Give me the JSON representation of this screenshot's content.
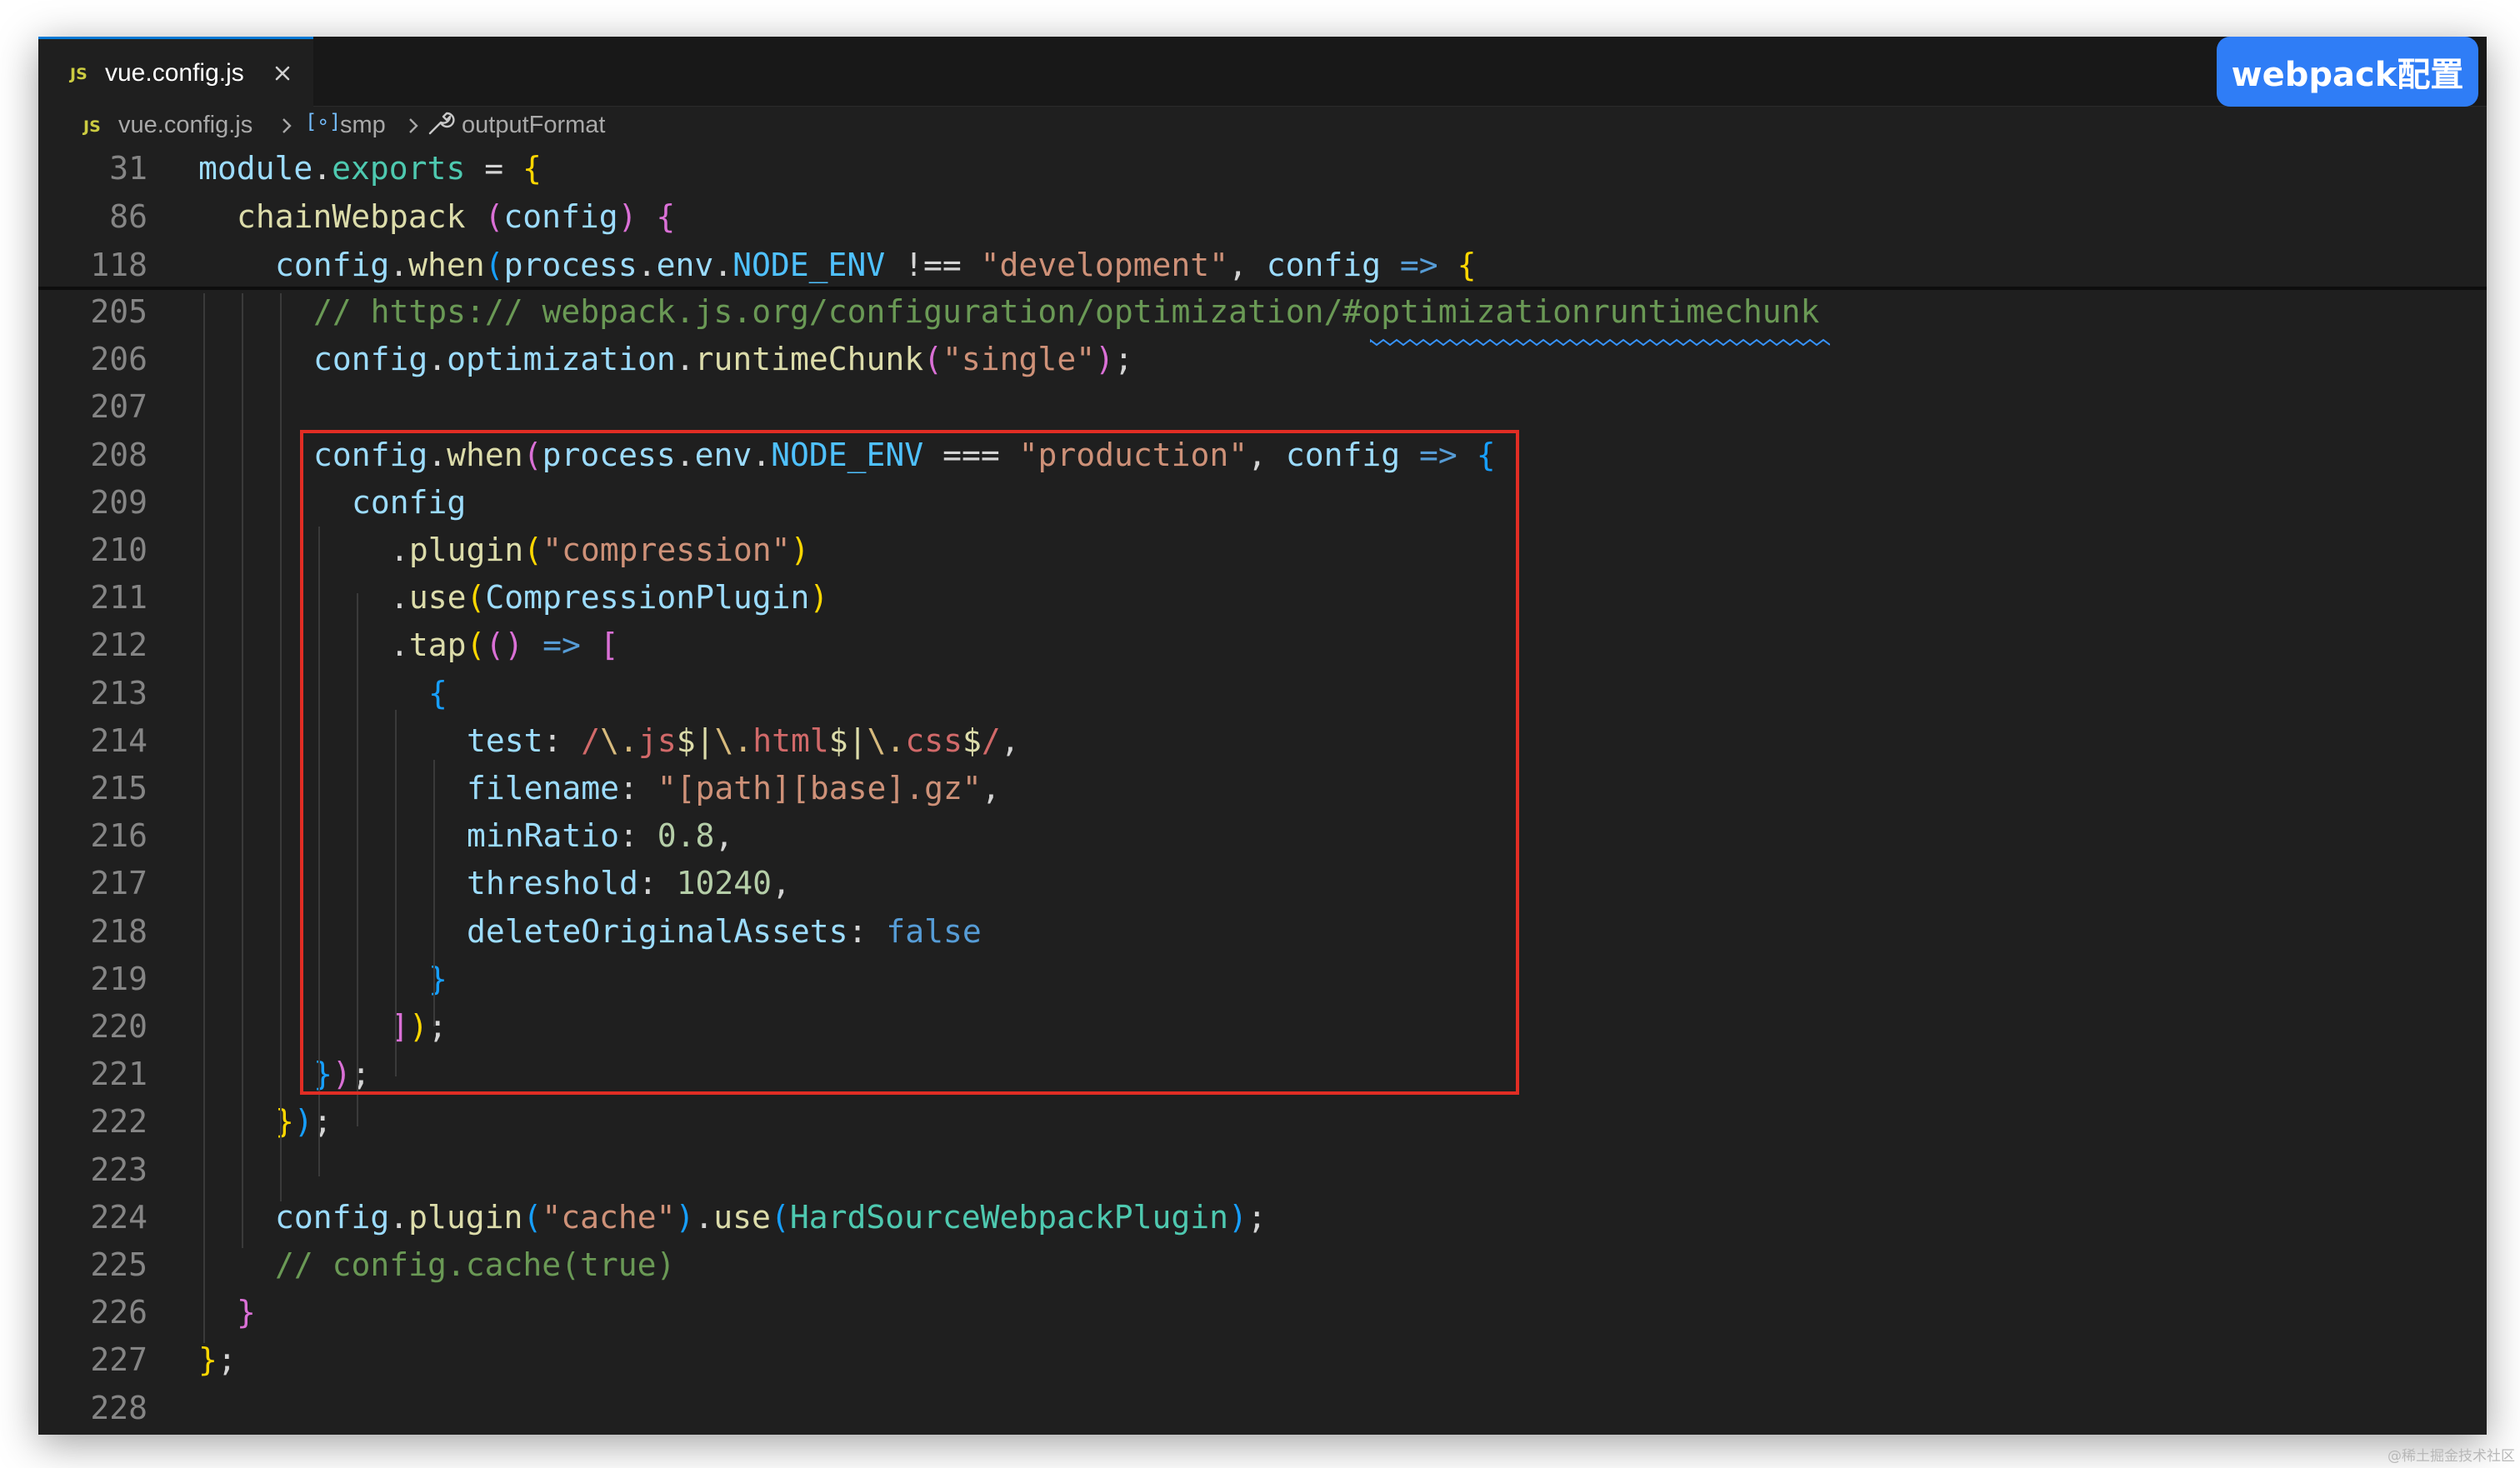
{
  "tab": {
    "badge": "JS",
    "label": "vue.config.js"
  },
  "badge_label": "webpack配置",
  "breadcrumb": {
    "js_badge": "JS",
    "file": "vue.config.js",
    "symbol": "smp",
    "method": "outputFormat",
    "variable_icon": "variable-icon",
    "method_icon": "wrench-icon"
  },
  "editor": {
    "sticky_lines": [
      {
        "number": "31",
        "indent": 0,
        "tokens": [
          {
            "t": "module",
            "c": "#9cdcfe"
          },
          {
            "t": ".",
            "c": "#d4d4d4"
          },
          {
            "t": "exports",
            "c": "#4ec9b0"
          },
          {
            "t": " = ",
            "c": "#d4d4d4"
          },
          {
            "t": "{",
            "c": "#ffd700"
          }
        ]
      },
      {
        "number": "86",
        "indent": 1,
        "tokens": [
          {
            "t": "chainWebpack",
            "c": "#dcdcaa"
          },
          {
            "t": " ",
            "c": "#d4d4d4"
          },
          {
            "t": "(",
            "c": "#da70d6"
          },
          {
            "t": "config",
            "c": "#9cdcfe"
          },
          {
            "t": ")",
            "c": "#da70d6"
          },
          {
            "t": " ",
            "c": "#d4d4d4"
          },
          {
            "t": "{",
            "c": "#da70d6"
          }
        ]
      },
      {
        "number": "118",
        "indent": 2,
        "tokens": [
          {
            "t": "config",
            "c": "#9cdcfe"
          },
          {
            "t": ".",
            "c": "#d4d4d4"
          },
          {
            "t": "when",
            "c": "#dcdcaa"
          },
          {
            "t": "(",
            "c": "#179fff"
          },
          {
            "t": "process",
            "c": "#9cdcfe"
          },
          {
            "t": ".",
            "c": "#d4d4d4"
          },
          {
            "t": "env",
            "c": "#9cdcfe"
          },
          {
            "t": ".",
            "c": "#d4d4d4"
          },
          {
            "t": "NODE_ENV",
            "c": "#4fc1ff"
          },
          {
            "t": " !== ",
            "c": "#d4d4d4"
          },
          {
            "t": "\"development\"",
            "c": "#ce9178"
          },
          {
            "t": ", ",
            "c": "#d4d4d4"
          },
          {
            "t": "config",
            "c": "#9cdcfe"
          },
          {
            "t": " => ",
            "c": "#569cd6"
          },
          {
            "t": "{",
            "c": "#ffd700"
          }
        ]
      }
    ],
    "lines": [
      {
        "number": "205",
        "indent": 3,
        "tokens": [
          {
            "t": "// https:// webpack.js.org/configuration/optimization/#optimizationruntimechunk",
            "c": "#6a9955"
          }
        ]
      },
      {
        "number": "206",
        "indent": 3,
        "tokens": [
          {
            "t": "config",
            "c": "#9cdcfe"
          },
          {
            "t": ".",
            "c": "#d4d4d4"
          },
          {
            "t": "optimization",
            "c": "#9cdcfe"
          },
          {
            "t": ".",
            "c": "#d4d4d4"
          },
          {
            "t": "runtimeChunk",
            "c": "#dcdcaa"
          },
          {
            "t": "(",
            "c": "#da70d6"
          },
          {
            "t": "\"single\"",
            "c": "#ce9178"
          },
          {
            "t": ")",
            "c": "#da70d6"
          },
          {
            "t": ";",
            "c": "#d4d4d4"
          }
        ]
      },
      {
        "number": "207",
        "indent": 0,
        "tokens": []
      },
      {
        "number": "208",
        "indent": 3,
        "tokens": [
          {
            "t": "config",
            "c": "#9cdcfe"
          },
          {
            "t": ".",
            "c": "#d4d4d4"
          },
          {
            "t": "when",
            "c": "#dcdcaa"
          },
          {
            "t": "(",
            "c": "#da70d6"
          },
          {
            "t": "process",
            "c": "#9cdcfe"
          },
          {
            "t": ".",
            "c": "#d4d4d4"
          },
          {
            "t": "env",
            "c": "#9cdcfe"
          },
          {
            "t": ".",
            "c": "#d4d4d4"
          },
          {
            "t": "NODE_ENV",
            "c": "#4fc1ff"
          },
          {
            "t": " === ",
            "c": "#d4d4d4"
          },
          {
            "t": "\"production\"",
            "c": "#ce9178"
          },
          {
            "t": ", ",
            "c": "#d4d4d4"
          },
          {
            "t": "config",
            "c": "#9cdcfe"
          },
          {
            "t": " => ",
            "c": "#569cd6"
          },
          {
            "t": "{",
            "c": "#179fff"
          }
        ]
      },
      {
        "number": "209",
        "indent": 4,
        "tokens": [
          {
            "t": "config",
            "c": "#9cdcfe"
          }
        ]
      },
      {
        "number": "210",
        "indent": 5,
        "tokens": [
          {
            "t": ".",
            "c": "#d4d4d4"
          },
          {
            "t": "plugin",
            "c": "#dcdcaa"
          },
          {
            "t": "(",
            "c": "#ffd700"
          },
          {
            "t": "\"compression\"",
            "c": "#ce9178"
          },
          {
            "t": ")",
            "c": "#ffd700"
          }
        ]
      },
      {
        "number": "211",
        "indent": 5,
        "tokens": [
          {
            "t": ".",
            "c": "#d4d4d4"
          },
          {
            "t": "use",
            "c": "#dcdcaa"
          },
          {
            "t": "(",
            "c": "#ffd700"
          },
          {
            "t": "CompressionPlugin",
            "c": "#9cdcfe"
          },
          {
            "t": ")",
            "c": "#ffd700"
          }
        ]
      },
      {
        "number": "212",
        "indent": 5,
        "tokens": [
          {
            "t": ".",
            "c": "#d4d4d4"
          },
          {
            "t": "tap",
            "c": "#dcdcaa"
          },
          {
            "t": "(",
            "c": "#ffd700"
          },
          {
            "t": "()",
            "c": "#da70d6"
          },
          {
            "t": " => ",
            "c": "#569cd6"
          },
          {
            "t": "[",
            "c": "#da70d6"
          }
        ]
      },
      {
        "number": "213",
        "indent": 6,
        "tokens": [
          {
            "t": "{",
            "c": "#179fff"
          }
        ]
      },
      {
        "number": "214",
        "indent": 7,
        "tokens": [
          {
            "t": "test",
            "c": "#9cdcfe"
          },
          {
            "t": ": ",
            "c": "#d4d4d4"
          },
          {
            "t": "/",
            "c": "#d16969"
          },
          {
            "t": "\\.",
            "c": "#d7ba7d"
          },
          {
            "t": "js",
            "c": "#d16969"
          },
          {
            "t": "$",
            "c": "#dcdcaa"
          },
          {
            "t": "|",
            "c": "#dcdcaa"
          },
          {
            "t": "\\.",
            "c": "#d7ba7d"
          },
          {
            "t": "html",
            "c": "#d16969"
          },
          {
            "t": "$",
            "c": "#dcdcaa"
          },
          {
            "t": "|",
            "c": "#dcdcaa"
          },
          {
            "t": "\\.",
            "c": "#d7ba7d"
          },
          {
            "t": "css",
            "c": "#d16969"
          },
          {
            "t": "$",
            "c": "#dcdcaa"
          },
          {
            "t": "/",
            "c": "#d16969"
          },
          {
            "t": ",",
            "c": "#d4d4d4"
          }
        ]
      },
      {
        "number": "215",
        "indent": 7,
        "tokens": [
          {
            "t": "filename",
            "c": "#9cdcfe"
          },
          {
            "t": ": ",
            "c": "#d4d4d4"
          },
          {
            "t": "\"[path][base].gz\"",
            "c": "#ce9178"
          },
          {
            "t": ",",
            "c": "#d4d4d4"
          }
        ]
      },
      {
        "number": "216",
        "indent": 7,
        "tokens": [
          {
            "t": "minRatio",
            "c": "#9cdcfe"
          },
          {
            "t": ": ",
            "c": "#d4d4d4"
          },
          {
            "t": "0.8",
            "c": "#b5cea8"
          },
          {
            "t": ",",
            "c": "#d4d4d4"
          }
        ]
      },
      {
        "number": "217",
        "indent": 7,
        "tokens": [
          {
            "t": "threshold",
            "c": "#9cdcfe"
          },
          {
            "t": ": ",
            "c": "#d4d4d4"
          },
          {
            "t": "10240",
            "c": "#b5cea8"
          },
          {
            "t": ",",
            "c": "#d4d4d4"
          }
        ]
      },
      {
        "number": "218",
        "indent": 7,
        "tokens": [
          {
            "t": "deleteOriginalAssets",
            "c": "#9cdcfe"
          },
          {
            "t": ": ",
            "c": "#d4d4d4"
          },
          {
            "t": "false",
            "c": "#569cd6"
          }
        ]
      },
      {
        "number": "219",
        "indent": 6,
        "tokens": [
          {
            "t": "}",
            "c": "#179fff"
          }
        ]
      },
      {
        "number": "220",
        "indent": 5,
        "tokens": [
          {
            "t": "]",
            "c": "#da70d6"
          },
          {
            "t": ")",
            "c": "#ffd700"
          },
          {
            "t": ";",
            "c": "#d4d4d4"
          }
        ]
      },
      {
        "number": "221",
        "indent": 3,
        "tokens": [
          {
            "t": "}",
            "c": "#179fff"
          },
          {
            "t": ")",
            "c": "#da70d6"
          },
          {
            "t": ";",
            "c": "#d4d4d4"
          }
        ]
      },
      {
        "number": "222",
        "indent": 2,
        "tokens": [
          {
            "t": "}",
            "c": "#ffd700"
          },
          {
            "t": ")",
            "c": "#179fff"
          },
          {
            "t": ";",
            "c": "#d4d4d4"
          }
        ]
      },
      {
        "number": "223",
        "indent": 0,
        "tokens": []
      },
      {
        "number": "224",
        "indent": 2,
        "tokens": [
          {
            "t": "config",
            "c": "#9cdcfe"
          },
          {
            "t": ".",
            "c": "#d4d4d4"
          },
          {
            "t": "plugin",
            "c": "#dcdcaa"
          },
          {
            "t": "(",
            "c": "#179fff"
          },
          {
            "t": "\"cache\"",
            "c": "#ce9178"
          },
          {
            "t": ")",
            "c": "#179fff"
          },
          {
            "t": ".",
            "c": "#d4d4d4"
          },
          {
            "t": "use",
            "c": "#dcdcaa"
          },
          {
            "t": "(",
            "c": "#179fff"
          },
          {
            "t": "HardSourceWebpackPlugin",
            "c": "#4ec9b0"
          },
          {
            "t": ")",
            "c": "#179fff"
          },
          {
            "t": ";",
            "c": "#d4d4d4"
          }
        ]
      },
      {
        "number": "225",
        "indent": 2,
        "tokens": [
          {
            "t": "// config.cache(true)",
            "c": "#6a9955"
          }
        ]
      },
      {
        "number": "226",
        "indent": 1,
        "tokens": [
          {
            "t": "}",
            "c": "#da70d6"
          }
        ]
      },
      {
        "number": "227",
        "indent": 0,
        "tokens": [
          {
            "t": "}",
            "c": "#ffd700"
          },
          {
            "t": ";",
            "c": "#d4d4d4"
          }
        ]
      },
      {
        "number": "228",
        "indent": 0,
        "tokens": []
      }
    ]
  },
  "watermark": "@稀土掘金技术社区"
}
